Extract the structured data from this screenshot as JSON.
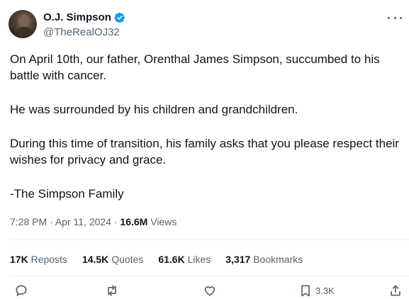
{
  "author": {
    "display_name": "O.J. Simpson",
    "handle": "@TheRealOJ32",
    "verified": true,
    "verified_color": "#1d9bf0"
  },
  "tweet": {
    "paragraphs": [
      "On April 10th, our father, Orenthal James Simpson, succumbed to his battle with cancer.",
      "He was surrounded by his children and grandchildren.",
      "During this time of transition, his family asks that you please respect their wishes for privacy and grace.",
      "-The Simpson Family"
    ]
  },
  "meta": {
    "time": "7:28 PM",
    "separator": "·",
    "date": "Apr 11, 2024",
    "views_count": "16.6M",
    "views_label": "Views"
  },
  "stats": {
    "reposts_count": "17K",
    "reposts_label": "Reposts",
    "quotes_count": "14.5K",
    "quotes_label": "Quotes",
    "likes_count": "61.6K",
    "likes_label": "Likes",
    "bookmarks_count": "3,317",
    "bookmarks_label": "Bookmarks"
  },
  "actions": {
    "reply_icon": "reply-icon",
    "repost_icon": "repost-icon",
    "like_icon": "heart-icon",
    "bookmark_icon": "bookmark-icon",
    "bookmark_count": "3.3K",
    "share_icon": "share-icon"
  },
  "colors": {
    "text_primary": "#0f1419",
    "text_secondary": "#536471",
    "divider": "#eff3f4"
  }
}
